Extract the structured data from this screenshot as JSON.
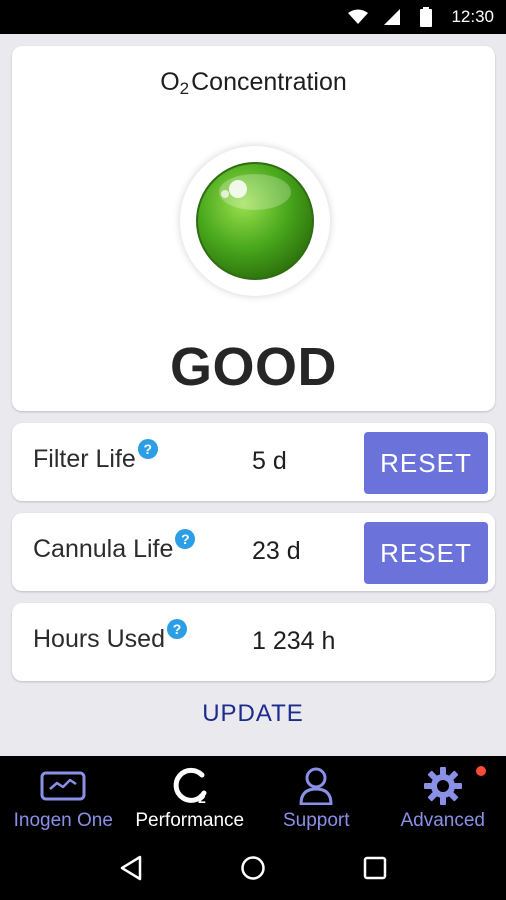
{
  "status_bar": {
    "time": "12:30"
  },
  "o2_card": {
    "title_o": "O",
    "title_sub": "2",
    "title_rest": "Concentration",
    "status": "GOOD",
    "indicator_color": "#3fa21a"
  },
  "rows": [
    {
      "label": "Filter Life",
      "help": "?",
      "value": "5 d",
      "button": "RESET"
    },
    {
      "label": "Cannula Life",
      "help": "?",
      "value": "23 d",
      "button": "RESET"
    },
    {
      "label": "Hours Used",
      "help": "?",
      "value": "1 234 h"
    }
  ],
  "update_label": "UPDATE",
  "nav": [
    {
      "label": "Inogen One",
      "icon": "monitor-icon"
    },
    {
      "label": "Performance",
      "icon": "o2-icon",
      "active": true
    },
    {
      "label": "Support",
      "icon": "person-icon"
    },
    {
      "label": "Advanced",
      "icon": "gear-icon",
      "badge": true
    }
  ],
  "colors": {
    "accent_button": "#6b73db",
    "nav_inactive": "#8a90e6",
    "update_text": "#1d2b8f",
    "help_icon": "#2c9ee6"
  }
}
